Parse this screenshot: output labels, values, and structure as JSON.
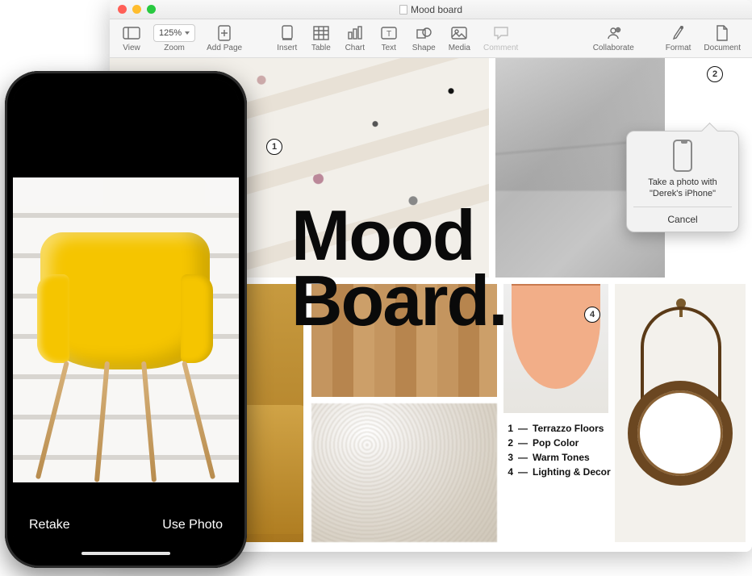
{
  "mac": {
    "title": "Mood board",
    "toolbar": {
      "view": "View",
      "zoom_value": "125%",
      "zoom_label": "Zoom",
      "add_page": "Add Page",
      "insert": "Insert",
      "table": "Table",
      "chart": "Chart",
      "text": "Text",
      "shape": "Shape",
      "media": "Media",
      "comment": "Comment",
      "collaborate": "Collaborate",
      "format": "Format",
      "document": "Document"
    },
    "callouts": {
      "c1": "1",
      "c2": "2",
      "c4": "4"
    },
    "board": {
      "title_line1": "Mood",
      "title_line2": "Board.",
      "legend": [
        {
          "n": "1",
          "dash": "—",
          "label": "Terrazzo Floors"
        },
        {
          "n": "2",
          "dash": "—",
          "label": "Pop Color"
        },
        {
          "n": "3",
          "dash": "—",
          "label": "Warm Tones"
        },
        {
          "n": "4",
          "dash": "—",
          "label": "Lighting & Decor"
        }
      ]
    },
    "popover": {
      "text_line1": "Take a photo with",
      "text_line2": "\"Derek's iPhone\"",
      "cancel": "Cancel"
    }
  },
  "iphone": {
    "retake": "Retake",
    "use_photo": "Use Photo"
  }
}
